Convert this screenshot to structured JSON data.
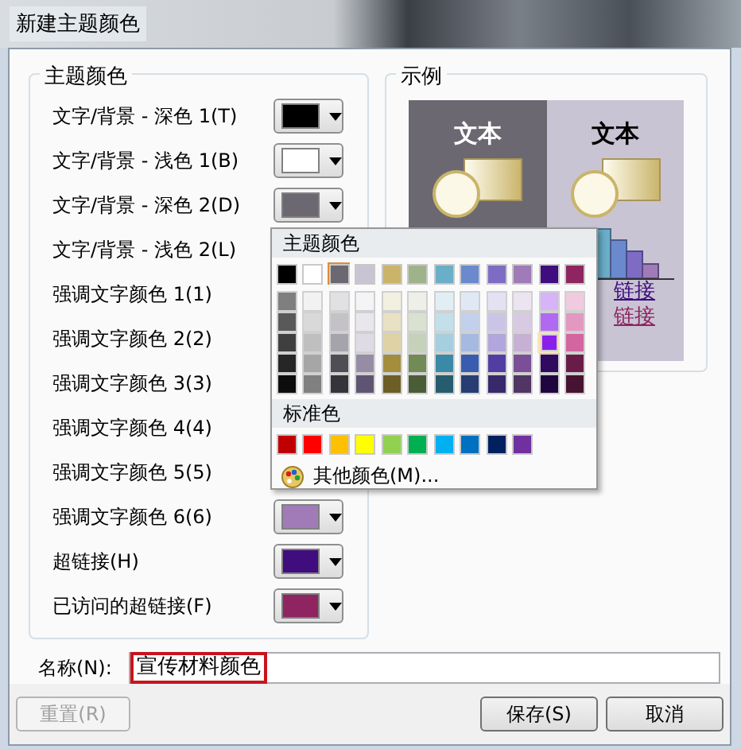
{
  "window": {
    "title": "新建主题颜色"
  },
  "theme_colors": {
    "title": "主题颜色",
    "rows": [
      {
        "label": "文字/背景 - 深色 1(T)",
        "color": "#000000"
      },
      {
        "label": "文字/背景 - 浅色 1(B)",
        "color": "#ffffff"
      },
      {
        "label": "文字/背景 - 深色 2(D)",
        "color": "#6b6872"
      },
      {
        "label": "文字/背景 - 浅色 2(L)"
      },
      {
        "label": "强调文字颜色 1(1)"
      },
      {
        "label": "强调文字颜色 2(2)"
      },
      {
        "label": "强调文字颜色 3(3)"
      },
      {
        "label": "强调文字颜色 4(4)"
      },
      {
        "label": "强调文字颜色 5(5)"
      },
      {
        "label": "强调文字颜色 6(6)",
        "color": "#a07bb8"
      },
      {
        "label": "超链接(H)",
        "color": "#3f0d7d"
      },
      {
        "label": "已访问的超链接(F)",
        "color": "#8e2560"
      }
    ]
  },
  "sample": {
    "title": "示例",
    "dark_text": "文本",
    "light_text": "文本",
    "links": [
      {
        "text": "链接",
        "color": "#3f0d7d"
      },
      {
        "text": "链接",
        "color": "#8e2560"
      }
    ]
  },
  "color_menu": {
    "theme_title": "主题颜色",
    "theme": [
      {
        "color": "#000000",
        "selected": false
      },
      {
        "color": "#ffffff",
        "selected": false
      },
      {
        "color": "#6b6872",
        "selected": true
      },
      {
        "color": "#c9c4d4",
        "selected": false
      },
      {
        "color": "#c9b46a",
        "selected": false
      },
      {
        "color": "#9fb38a",
        "selected": false
      },
      {
        "color": "#6aaec8",
        "selected": false
      },
      {
        "color": "#6a8acd",
        "selected": false
      },
      {
        "color": "#7e6cc4",
        "selected": false
      },
      {
        "color": "#a07bb8",
        "selected": false
      },
      {
        "color": "#3f0d7d",
        "selected": false
      },
      {
        "color": "#8e2560",
        "selected": false
      }
    ],
    "shades": [
      [
        {
          "color": "#7f7f7f",
          "selected": false
        },
        {
          "color": "#595959",
          "selected": false
        },
        {
          "color": "#3f3f3f",
          "selected": false
        },
        {
          "color": "#262626",
          "selected": false
        },
        {
          "color": "#0d0d0d",
          "selected": false
        }
      ],
      [
        {
          "color": "#f2f2f2",
          "selected": false
        },
        {
          "color": "#d9d9d9",
          "selected": false
        },
        {
          "color": "#bfbfbf",
          "selected": false
        },
        {
          "color": "#a6a6a6",
          "selected": false
        },
        {
          "color": "#808080",
          "selected": false
        }
      ],
      [
        {
          "color": "#e1e0e3",
          "selected": false
        },
        {
          "color": "#c4c2c7",
          "selected": false
        },
        {
          "color": "#a6a4ab",
          "selected": false
        },
        {
          "color": "#504e55",
          "selected": false
        },
        {
          "color": "#35343a",
          "selected": false
        }
      ],
      [
        {
          "color": "#f4f3f6",
          "selected": false
        },
        {
          "color": "#e9e7ed",
          "selected": false
        },
        {
          "color": "#dedbe4",
          "selected": false
        },
        {
          "color": "#968ca6",
          "selected": false
        },
        {
          "color": "#5f5573",
          "selected": false
        }
      ],
      [
        {
          "color": "#f4f0e1",
          "selected": false
        },
        {
          "color": "#e9e1c3",
          "selected": false
        },
        {
          "color": "#dfd3a5",
          "selected": false
        },
        {
          "color": "#a48d3c",
          "selected": false
        },
        {
          "color": "#6d5e28",
          "selected": false
        }
      ],
      [
        {
          "color": "#ecf0e8",
          "selected": false
        },
        {
          "color": "#d9e1d0",
          "selected": false
        },
        {
          "color": "#c5d1b9",
          "selected": false
        },
        {
          "color": "#718a56",
          "selected": false
        },
        {
          "color": "#4b5c39",
          "selected": false
        }
      ],
      [
        {
          "color": "#e1eff4",
          "selected": false
        },
        {
          "color": "#c3dfe9",
          "selected": false
        },
        {
          "color": "#a5cede",
          "selected": false
        },
        {
          "color": "#3a8aa7",
          "selected": false
        },
        {
          "color": "#275c6f",
          "selected": false
        }
      ],
      [
        {
          "color": "#e1e8f5",
          "selected": false
        },
        {
          "color": "#c3d0eb",
          "selected": false
        },
        {
          "color": "#a5b9e1",
          "selected": false
        },
        {
          "color": "#3a5cae",
          "selected": false
        },
        {
          "color": "#273d74",
          "selected": false
        }
      ],
      [
        {
          "color": "#e5e1f3",
          "selected": false
        },
        {
          "color": "#cbc4e7",
          "selected": false
        },
        {
          "color": "#b2a7dc",
          "selected": false
        },
        {
          "color": "#523da2",
          "selected": false
        },
        {
          "color": "#37296c",
          "selected": false
        }
      ],
      [
        {
          "color": "#ece4f1",
          "selected": false
        },
        {
          "color": "#d9cae3",
          "selected": false
        },
        {
          "color": "#c6b0d4",
          "selected": false
        },
        {
          "color": "#7a4f97",
          "selected": false
        },
        {
          "color": "#513565",
          "selected": false
        }
      ],
      [
        {
          "color": "#d7b4f8",
          "selected": false
        },
        {
          "color": "#b06af2",
          "selected": false
        },
        {
          "color": "#8a1feb",
          "selected": true
        },
        {
          "color": "#2f0a5e",
          "selected": false
        },
        {
          "color": "#1f063e",
          "selected": false
        }
      ],
      [
        {
          "color": "#f0cbe0",
          "selected": false
        },
        {
          "color": "#e298c0",
          "selected": false
        },
        {
          "color": "#d365a1",
          "selected": false
        },
        {
          "color": "#6a1c48",
          "selected": false
        },
        {
          "color": "#461330",
          "selected": false
        }
      ]
    ],
    "standard_title": "标准色",
    "standard": [
      {
        "color": "#c00000"
      },
      {
        "color": "#ff0000"
      },
      {
        "color": "#ffc000"
      },
      {
        "color": "#ffff00"
      },
      {
        "color": "#92d050"
      },
      {
        "color": "#00b050"
      },
      {
        "color": "#00b0f0"
      },
      {
        "color": "#0070c0"
      },
      {
        "color": "#002060"
      },
      {
        "color": "#7030a0"
      }
    ],
    "more": "其他颜色(M)..."
  },
  "name": {
    "label": "名称(N):",
    "value": "宣传材料颜色"
  },
  "buttons": [
    {
      "label": "重置(R)",
      "disabled": true
    },
    {
      "label": "保存(S)",
      "disabled": false
    },
    {
      "label": "取消",
      "disabled": false
    }
  ]
}
